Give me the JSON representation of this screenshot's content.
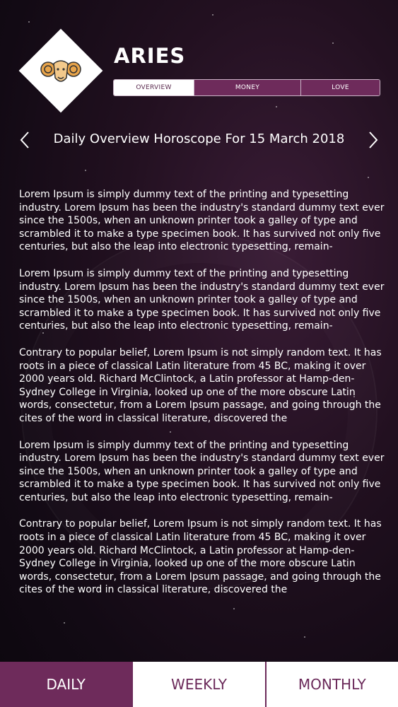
{
  "header": {
    "sign_name": "ARIES",
    "sign_icon": "ram-head-icon"
  },
  "top_tabs": [
    {
      "label": "OVERVIEW",
      "active": true
    },
    {
      "label": "MONEY",
      "active": false
    },
    {
      "label": "LOVE",
      "active": false
    }
  ],
  "date_nav": {
    "title": "Daily Overview Horoscope For 15 March 2018",
    "prev_icon": "chevron-left-icon",
    "next_icon": "chevron-right-icon"
  },
  "paragraphs": [
    "Lorem Ipsum is simply dummy text of the printing and typesetting industry. Lorem Ipsum has been the industry's standard dummy text ever since the 1500s, when an unknown printer took a galley of type and scrambled it to make a type specimen book. It has survived not only five centuries, but also the leap into electronic typesetting, remain-",
    "Lorem Ipsum is simply dummy text of the printing and typesetting industry. Lorem Ipsum has been the industry's standard dummy text ever since the 1500s, when an unknown printer took a galley of type and scrambled it to make a type specimen book. It has survived not only five centuries, but also the leap into electronic typesetting, remain-",
    "Contrary to popular belief, Lorem Ipsum is not simply random text. It has roots in a piece of classical Latin literature from 45 BC, making it over 2000 years old. Richard McClintock, a Latin professor at Hamp-den-Sydney College in Virginia, looked up one of the more obscure Latin words, consectetur, from a Lorem Ipsum passage, and going through the cites of the word in classical literature, discovered the",
    "Lorem Ipsum is simply dummy text of the printing and typesetting industry. Lorem Ipsum has been the industry's standard dummy text ever since the 1500s, when an unknown printer took a galley of type and scrambled it to make a type specimen book. It has survived not only five centuries, but also the leap into electronic typesetting, remain-",
    "Contrary to popular belief, Lorem Ipsum is not simply random text. It has roots in a piece of classical Latin literature from 45 BC, making it over 2000 years old. Richard McClintock, a Latin professor at Hamp-den-Sydney College in Virginia, looked up one of the more obscure Latin words, consectetur, from a Lorem Ipsum passage, and going through the cites of the word in classical literature, discovered the"
  ],
  "bottom_tabs": [
    {
      "label": "DAILY",
      "active": true
    },
    {
      "label": "WEEKLY",
      "active": false
    },
    {
      "label": "MONTHLY",
      "active": false
    }
  ],
  "colors": {
    "accent": "#6e2b5b",
    "background": "#1a0d18",
    "text": "#ffffff"
  }
}
